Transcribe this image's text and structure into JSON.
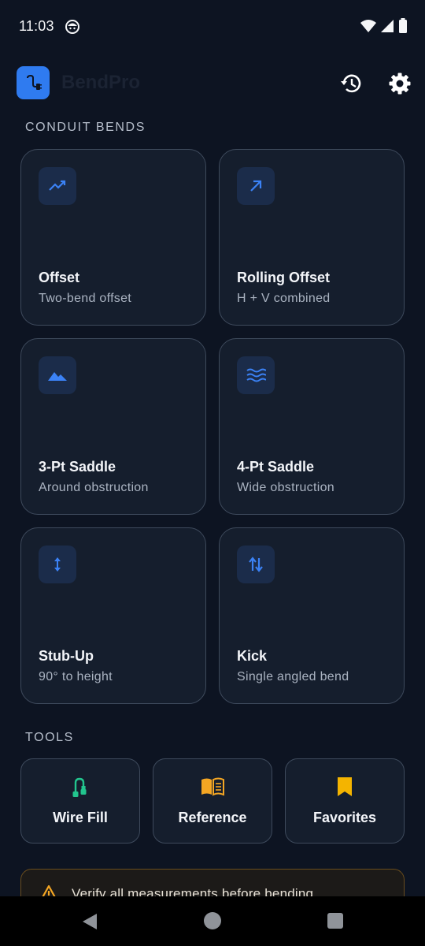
{
  "status_bar": {
    "time": "11:03",
    "icons": [
      "notification-face-icon",
      "wifi-icon",
      "signal-icon",
      "battery-icon"
    ]
  },
  "header": {
    "app_name": "BendPro",
    "logo_icon": "plug-icon",
    "actions": [
      "history-icon",
      "settings-gear-icon"
    ]
  },
  "conduit_section": {
    "label": "CONDUIT BENDS",
    "cards": [
      {
        "title": "Offset",
        "subtitle": "Two-bend offset",
        "icon": "trending-line-icon"
      },
      {
        "title": "Rolling Offset",
        "subtitle": "H + V combined",
        "icon": "arrow-up-right-icon"
      },
      {
        "title": "3-Pt Saddle",
        "subtitle": "Around obstruction",
        "icon": "mountain-icon"
      },
      {
        "title": "4-Pt Saddle",
        "subtitle": "Wide obstruction",
        "icon": "waves-icon"
      },
      {
        "title": "Stub-Up",
        "subtitle": "90° to height",
        "icon": "vertical-arrows-icon"
      },
      {
        "title": "Kick",
        "subtitle": "Single angled bend",
        "icon": "swap-vertical-icon"
      }
    ]
  },
  "tools_section": {
    "label": "TOOLS",
    "items": [
      {
        "label": "Wire Fill",
        "icon": "cable-icon",
        "color": "#22c58e"
      },
      {
        "label": "Reference",
        "icon": "book-icon",
        "color": "#f4a623"
      },
      {
        "label": "Favorites",
        "icon": "bookmark-icon",
        "color": "#f4b400"
      }
    ]
  },
  "warning": {
    "text": "Verify all measurements before bending.",
    "icon": "warning-triangle-icon",
    "color": "#f4a623"
  },
  "colors": {
    "background": "#0d1422",
    "card": "#151e2d",
    "accent": "#2f7bf0",
    "icon_blue": "#3b82f6"
  }
}
